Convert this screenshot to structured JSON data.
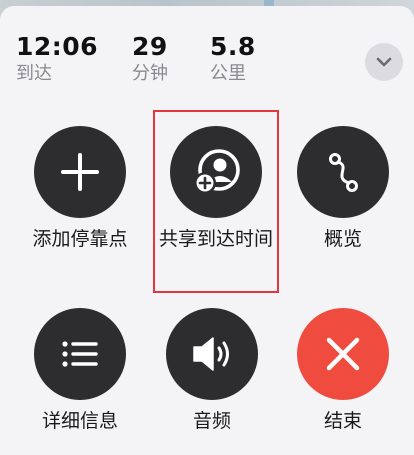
{
  "trip": {
    "arrival_time": "12:06",
    "arrival_label": "到达",
    "duration_value": "29",
    "duration_unit": "分钟",
    "distance_value": "5.8",
    "distance_unit": "公里"
  },
  "actions": [
    {
      "label": "添加停靠点",
      "icon": "plus-icon"
    },
    {
      "label": "共享到达时间",
      "icon": "share-eta-icon"
    },
    {
      "label": "概览",
      "icon": "route-overview-icon"
    },
    {
      "label": "详细信息",
      "icon": "list-icon"
    },
    {
      "label": "音频",
      "icon": "speaker-icon"
    },
    {
      "label": "结束",
      "icon": "close-icon"
    }
  ],
  "colors": {
    "button_dark": "#2d2d30",
    "end_red": "#ef4b3e",
    "highlight": "#e2383d"
  }
}
